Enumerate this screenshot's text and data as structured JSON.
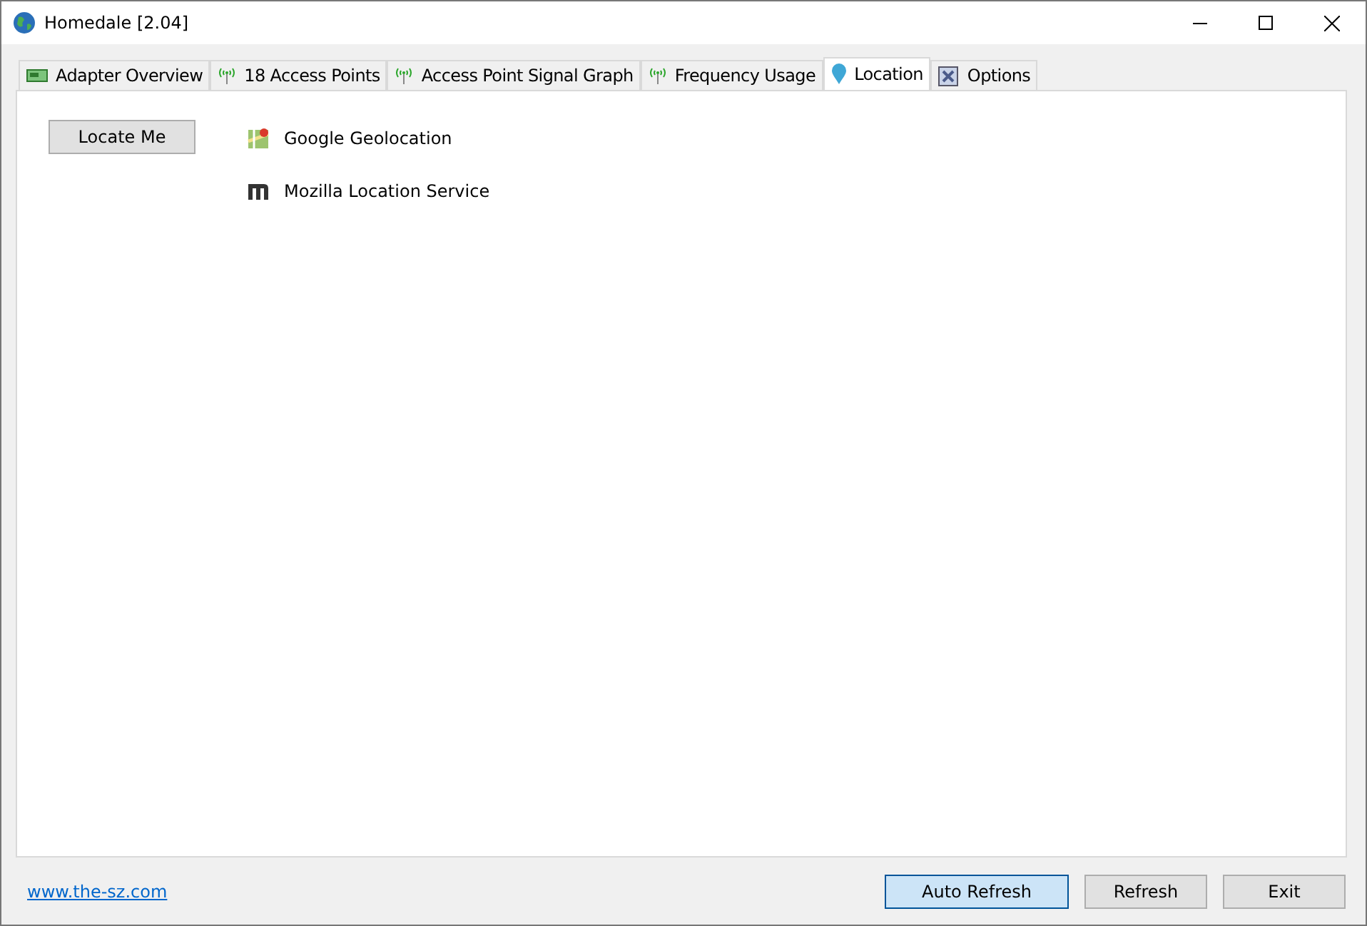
{
  "window": {
    "title": "Homedale [2.04]"
  },
  "tabs": [
    {
      "label": "Adapter Overview",
      "kind": "adapter",
      "selected": false
    },
    {
      "label": "18 Access Points",
      "kind": "signal",
      "selected": false
    },
    {
      "label": "Access Point Signal Graph",
      "kind": "signal",
      "selected": false
    },
    {
      "label": "Frequency Usage",
      "kind": "signal",
      "selected": false
    },
    {
      "label": "Location",
      "kind": "location",
      "selected": true
    },
    {
      "label": "Options",
      "kind": "options",
      "selected": false
    }
  ],
  "locate_button": "Locate Me",
  "services": [
    {
      "label": "Google Geolocation",
      "kind": "google"
    },
    {
      "label": "Mozilla Location Service",
      "kind": "mozilla"
    }
  ],
  "footer": {
    "link": "www.the-sz.com",
    "buttons": [
      {
        "label": "Auto Refresh",
        "on": true
      },
      {
        "label": "Refresh",
        "on": false
      },
      {
        "label": "Exit",
        "on": false
      }
    ]
  }
}
